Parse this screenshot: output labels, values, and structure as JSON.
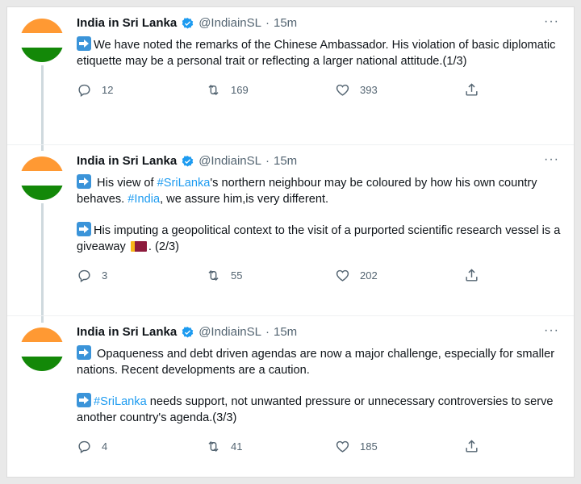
{
  "tweets": [
    {
      "name": "India in Sri Lanka",
      "handle": "@IndiainSL",
      "dot": "·",
      "time": "15m",
      "more": "···",
      "paragraphs": [
        {
          "parts": [
            {
              "type": "arrow"
            },
            {
              "type": "text",
              "text": "We have noted the remarks of the Chinese Ambassador. His violation of basic diplomatic etiquette may be a personal trait or reflecting a larger national attitude.(1/3)"
            }
          ]
        }
      ],
      "replies": "12",
      "retweets": "169",
      "likes": "393"
    },
    {
      "name": "India in Sri Lanka",
      "handle": "@IndiainSL",
      "dot": "·",
      "time": "15m",
      "more": "···",
      "paragraphs": [
        {
          "parts": [
            {
              "type": "arrow"
            },
            {
              "type": "text",
              "text": " His view of "
            },
            {
              "type": "link",
              "text": "#SriLanka"
            },
            {
              "type": "text",
              "text": "'s northern neighbour may be coloured by how his own country behaves. "
            },
            {
              "type": "link",
              "text": "#India"
            },
            {
              "type": "text",
              "text": ", we assure him,is very different."
            }
          ]
        },
        {
          "parts": [
            {
              "type": "arrow"
            },
            {
              "type": "text",
              "text": "His imputing a geopolitical context to the visit of a purported scientific research vessel is a giveaway "
            },
            {
              "type": "flag"
            },
            {
              "type": "text",
              "text": ". (2/3)"
            }
          ]
        }
      ],
      "replies": "3",
      "retweets": "55",
      "likes": "202"
    },
    {
      "name": "India in Sri Lanka",
      "handle": "@IndiainSL",
      "dot": "·",
      "time": "15m",
      "more": "···",
      "paragraphs": [
        {
          "parts": [
            {
              "type": "arrow"
            },
            {
              "type": "text",
              "text": " Opaqueness and debt driven agendas are now a major challenge, especially for smaller nations. Recent developments are a caution."
            }
          ]
        },
        {
          "parts": [
            {
              "type": "arrow"
            },
            {
              "type": "link",
              "text": "#SriLanka"
            },
            {
              "type": "text",
              "text": " needs support, not unwanted pressure or unnecessary controversies to serve another country's agenda.(3/3)"
            }
          ]
        }
      ],
      "replies": "4",
      "retweets": "41",
      "likes": "185"
    }
  ],
  "icons": {
    "verified": "verified-badge-icon",
    "reply": "reply-icon",
    "retweet": "retweet-icon",
    "like": "heart-icon",
    "share": "share-icon",
    "more": "more-icon",
    "arrow": "right-arrow-emoji-icon",
    "flag": "sri-lanka-flag-emoji-icon"
  },
  "colors": {
    "link": "#1d9bf0",
    "verified": "#1d9bf0",
    "muted": "#536471",
    "text": "#0f1419"
  }
}
